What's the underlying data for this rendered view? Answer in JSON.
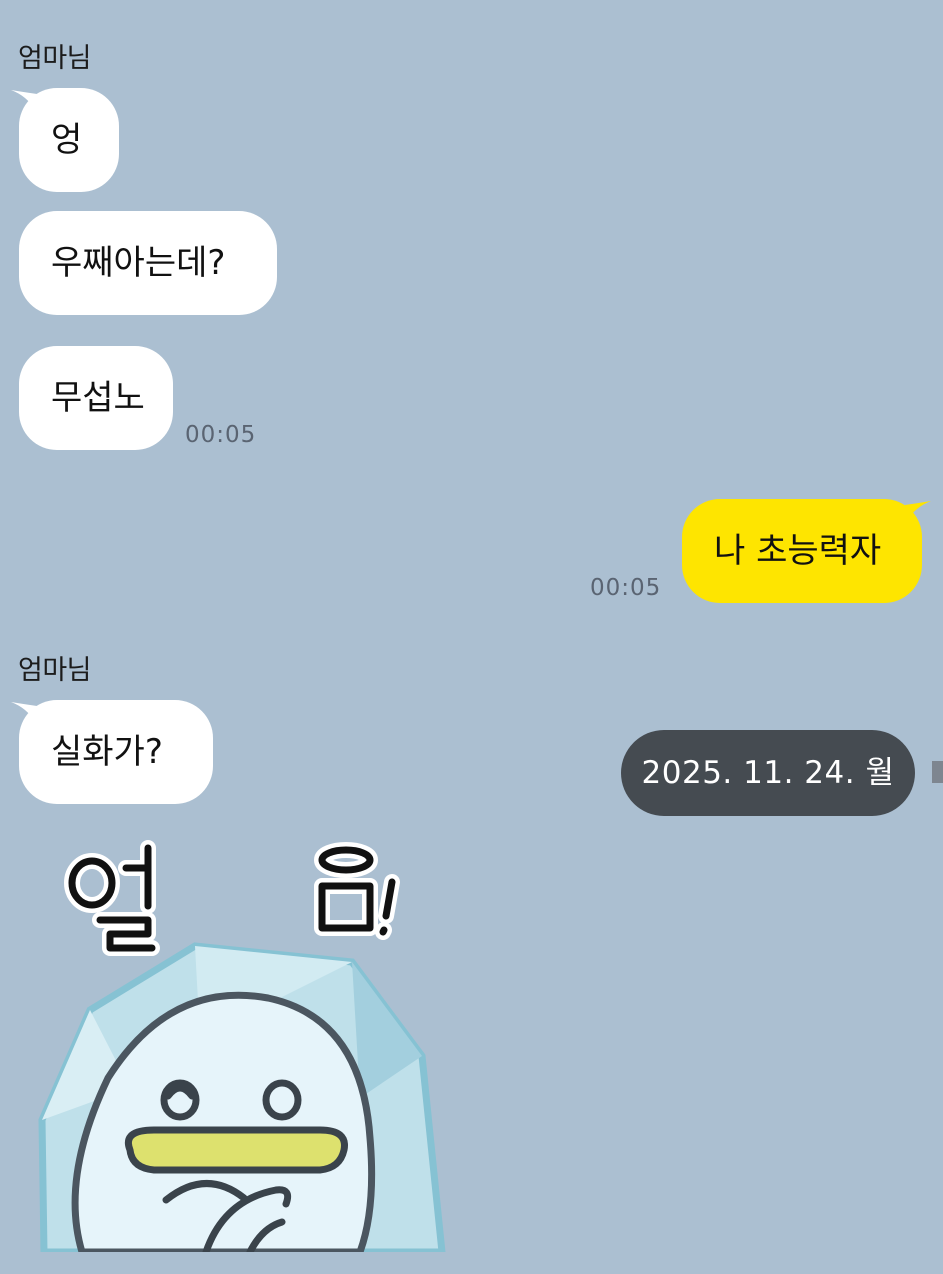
{
  "colors": {
    "background": "#abbfd1",
    "received_bubble": "#ffffff",
    "sent_bubble": "#fee500",
    "date_pill": "#454b51"
  },
  "messages": [
    {
      "sender": "엄마님",
      "direction": "received",
      "text": "엉"
    },
    {
      "direction": "received",
      "text": "우째아는데?"
    },
    {
      "direction": "received",
      "text": "무섭노",
      "time": "00:05"
    },
    {
      "direction": "sent",
      "text": "나 초능력자",
      "time": "00:05"
    },
    {
      "sender": "엄마님",
      "direction": "received",
      "text": "실화가?"
    }
  ],
  "date_divider": "2025. 11. 24. 월",
  "sticker": {
    "name": "ice-bird-sticker",
    "caption": "얼 음!"
  }
}
